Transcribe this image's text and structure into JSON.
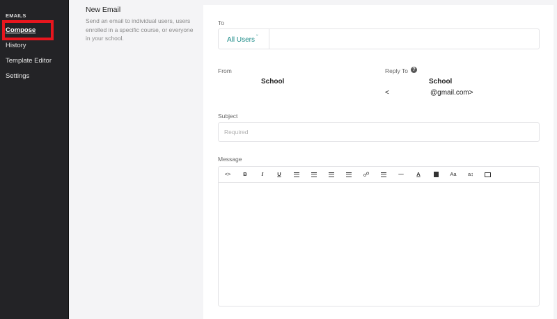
{
  "sidebar": {
    "section_label": "EMAILS",
    "items": [
      {
        "label": "Compose",
        "active": true
      },
      {
        "label": "History"
      },
      {
        "label": "Template Editor"
      },
      {
        "label": "Settings"
      }
    ]
  },
  "intro": {
    "title": "New Email",
    "description": "Send an email to individual users, users enrolled in a specific course, or everyone in your school."
  },
  "form": {
    "to_label": "To",
    "to_value": "All Users",
    "from_label": "From",
    "from_name": "School",
    "reply_to_label": "Reply To",
    "reply_to_name": "School",
    "reply_to_open": "<",
    "reply_to_email": "@gmail.com>",
    "subject_label": "Subject",
    "subject_placeholder": "Required",
    "message_label": "Message"
  },
  "toolbar": {
    "code": "<>",
    "bold": "B",
    "italic": "I",
    "underline": "U",
    "font_color": "A",
    "font_size": "Aa",
    "text_height": "a↕"
  },
  "colors": {
    "sidebar_bg": "#232326",
    "accent": "#1a8a87",
    "highlight": "#e8161e"
  }
}
